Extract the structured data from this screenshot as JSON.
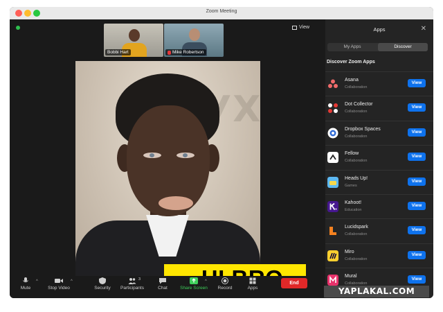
{
  "window": {
    "title": "Zoom Meeting"
  },
  "header": {
    "view_label": "View"
  },
  "participants": [
    {
      "name": "Bobbi Hart",
      "muted": false
    },
    {
      "name": "Mike Robertson",
      "muted": true
    }
  ],
  "main_video": {
    "watermark_text": "ГУХА",
    "caption": "- HI BRO"
  },
  "toolbar": {
    "mute": "Mute",
    "stop_video": "Stop Video",
    "security": "Security",
    "participants": "Participants",
    "participants_count": "3",
    "chat": "Chat",
    "share_screen": "Share Screen",
    "record": "Record",
    "apps": "Apps",
    "end": "End"
  },
  "apps_panel": {
    "title": "Apps",
    "tabs": [
      "My Apps",
      "Discover"
    ],
    "active_tab": "Discover",
    "section_title": "Discover Zoom Apps",
    "view_label": "View",
    "apps": [
      {
        "name": "Asana",
        "category": "Collaboration",
        "icon": "asana-icon"
      },
      {
        "name": "Dot Collector",
        "category": "Collaboration",
        "icon": "dot-collector-icon"
      },
      {
        "name": "Dropbox Spaces",
        "category": "Collaboration",
        "icon": "dropbox-icon"
      },
      {
        "name": "Fellow",
        "category": "Collaboration",
        "icon": "fellow-icon"
      },
      {
        "name": "Heads Up!",
        "category": "Games",
        "icon": "heads-up-icon"
      },
      {
        "name": "Kahoot!",
        "category": "Education",
        "icon": "kahoot-icon"
      },
      {
        "name": "Lucidspark",
        "category": "Collaboration",
        "icon": "lucidspark-icon"
      },
      {
        "name": "Miro",
        "category": "Collaboration",
        "icon": "miro-icon"
      },
      {
        "name": "Mural",
        "category": "Collaboration",
        "icon": "mural-icon"
      }
    ]
  },
  "site_watermark": "YAPLAKAL.COM",
  "colors": {
    "accent_blue": "#0e72ed",
    "end_red": "#e02828",
    "caption_yellow": "#ffe600",
    "share_green": "#3ecf5a"
  }
}
